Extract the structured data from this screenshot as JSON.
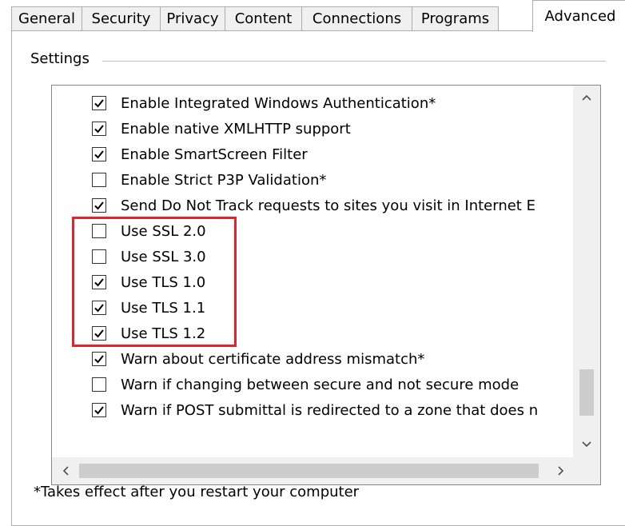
{
  "tabs": [
    {
      "label": "General",
      "active": false
    },
    {
      "label": "Security",
      "active": false
    },
    {
      "label": "Privacy",
      "active": false
    },
    {
      "label": "Content",
      "active": false
    },
    {
      "label": "Connections",
      "active": false
    },
    {
      "label": "Programs",
      "active": false
    },
    {
      "label": "Advanced",
      "active": true
    }
  ],
  "settings_label": "Settings",
  "settings": [
    {
      "label": "Enable Integrated Windows Authentication*",
      "checked": true
    },
    {
      "label": "Enable native XMLHTTP support",
      "checked": true
    },
    {
      "label": "Enable SmartScreen Filter",
      "checked": true
    },
    {
      "label": "Enable Strict P3P Validation*",
      "checked": false
    },
    {
      "label": "Send Do Not Track requests to sites you visit in Internet E",
      "checked": true
    },
    {
      "label": "Use SSL 2.0",
      "checked": false
    },
    {
      "label": "Use SSL 3.0",
      "checked": false
    },
    {
      "label": "Use TLS 1.0",
      "checked": true
    },
    {
      "label": "Use TLS 1.1",
      "checked": true
    },
    {
      "label": "Use TLS 1.2",
      "checked": true
    },
    {
      "label": "Warn about certificate address mismatch*",
      "checked": true
    },
    {
      "label": "Warn if changing between secure and not secure mode",
      "checked": false
    },
    {
      "label": "Warn if POST submittal is redirected to a zone that does n",
      "checked": true
    }
  ],
  "highlight_color": "#e0242a",
  "footnote": "*Takes effect after you restart your computer",
  "icons": {
    "up": "chevron-up-icon",
    "down": "chevron-down-icon",
    "left": "chevron-left-icon",
    "right": "chevron-right-icon",
    "check": "checkmark-icon"
  }
}
